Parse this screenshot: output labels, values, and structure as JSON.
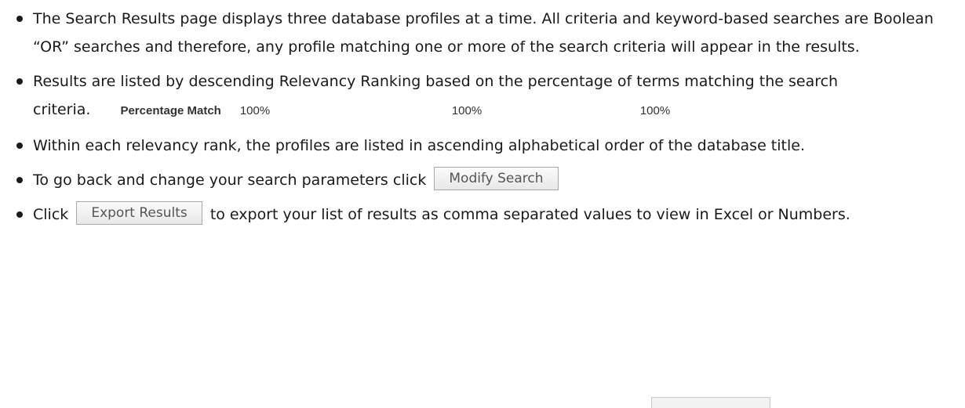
{
  "bullets": [
    {
      "text": "The Search Results page displays three database profiles at a time. All criteria and keyword-based searches are Boolean “OR” searches and therefore, any profile matching one or more of the search criteria will appear in the results."
    },
    {
      "text": "Results are listed by descending Relevancy Ranking based on the percentage of terms matching the search criteria.",
      "match_label": "Percentage Match",
      "match_values": [
        "100%",
        "100%",
        "100%"
      ]
    },
    {
      "text": "Within each relevancy rank, the profiles are listed in ascending alphabetical order of the database title."
    },
    {
      "text_before": "To go back and change your search parameters click",
      "button_label": "Modify Search"
    },
    {
      "text_before": "Click",
      "button_label": "Export Results",
      "text_after": "to export your list of results as comma separated values to view in Excel or Numbers."
    }
  ]
}
